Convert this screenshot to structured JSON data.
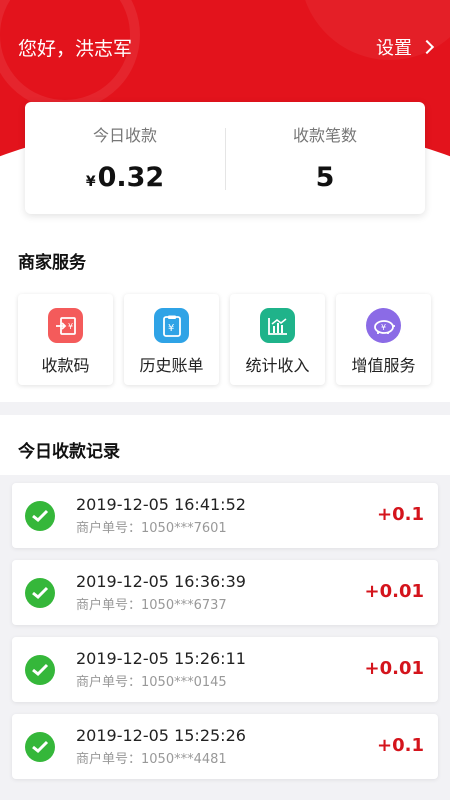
{
  "header": {
    "greeting": "您好，洪志军",
    "settings_label": "设置"
  },
  "summary": {
    "today_label": "今日收款",
    "currency": "¥",
    "today_amount": "0.32",
    "count_label": "收款笔数",
    "count_value": "5"
  },
  "services": {
    "title": "商家服务",
    "items": [
      {
        "label": "收款码",
        "icon": "qr-payment-icon",
        "color": "#f45b5b"
      },
      {
        "label": "历史账单",
        "icon": "bill-icon",
        "color": "#2fa3e6"
      },
      {
        "label": "统计收入",
        "icon": "chart-icon",
        "color": "#1fb38a"
      },
      {
        "label": "增值服务",
        "icon": "piggy-bank-icon",
        "color": "#8b6be6"
      }
    ]
  },
  "records": {
    "title": "今日收款记录",
    "order_prefix": "商户单号：",
    "items": [
      {
        "time": "2019-12-05 16:41:52",
        "order": "1050***7601",
        "amount": "+0.1"
      },
      {
        "time": "2019-12-05 16:36:39",
        "order": "1050***6737",
        "amount": "+0.01"
      },
      {
        "time": "2019-12-05 15:26:11",
        "order": "1050***0145",
        "amount": "+0.01"
      },
      {
        "time": "2019-12-05 15:25:26",
        "order": "1050***4481",
        "amount": "+0.1"
      }
    ]
  }
}
